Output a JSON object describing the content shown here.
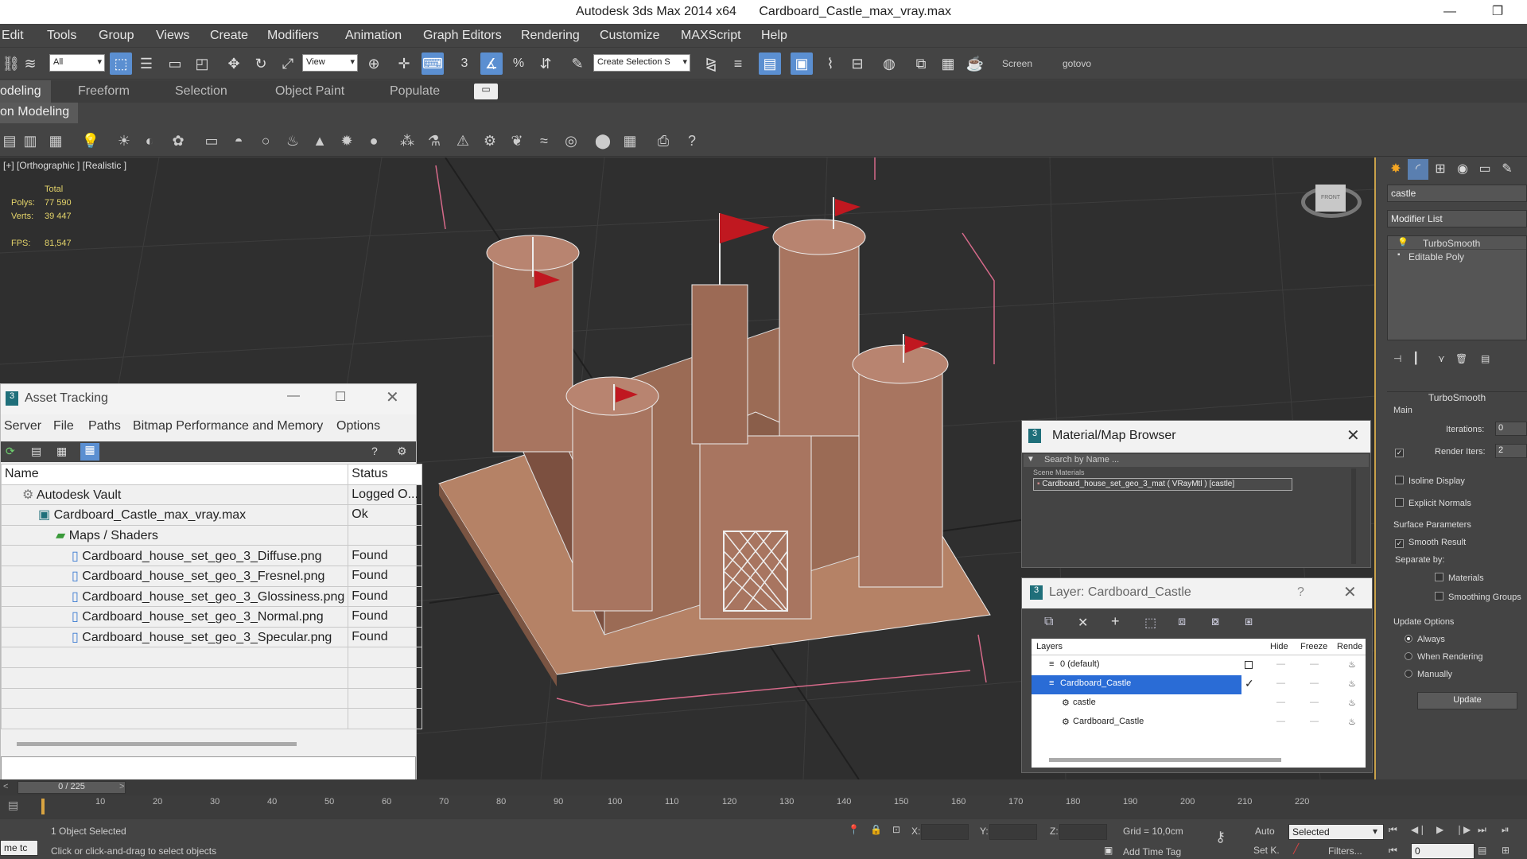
{
  "window": {
    "app_title": "Autodesk 3ds Max  2014 x64",
    "file_title": "Cardboard_Castle_max_vray.max",
    "minimize": "—",
    "restore": "❐"
  },
  "menu": [
    "Edit",
    "Tools",
    "Group",
    "Views",
    "Create",
    "Modifiers",
    "Animation",
    "Graph Editors",
    "Rendering",
    "Customize",
    "MAXScript",
    "Help"
  ],
  "toolbar": {
    "filter_select": "All",
    "view_select": "View",
    "selection_set_placeholder": "Create Selection S",
    "screen_label": "Screen",
    "gotovo_label": "gotovo",
    "snap_3": "3",
    "percent": "%"
  },
  "ribbon": {
    "tabs": [
      "odeling",
      "Freeform",
      "Selection",
      "Object Paint",
      "Populate"
    ],
    "sub_label": "on Modeling"
  },
  "viewport": {
    "label": "[+] [Orthographic ] [Realistic ]",
    "stats": {
      "total_label": "Total",
      "polys_label": "Polys:",
      "polys_value": "77 590",
      "verts_label": "Verts:",
      "verts_value": "39 447",
      "fps_label": "FPS:",
      "fps_value": "81,547"
    },
    "viewcube_label": "FRONT"
  },
  "command_panel": {
    "name_field": "castle",
    "modifier_list": "Modifier List",
    "stack": [
      "TurboSmooth",
      "Editable Poly"
    ],
    "rollout_title": "TurboSmooth",
    "main_label": "Main",
    "iterations_label": "Iterations:",
    "iterations_value": "0",
    "render_iters_label": "Render Iters:",
    "render_iters_value": "2",
    "isoline_label": "Isoline Display",
    "explicit_normals_label": "Explicit Normals",
    "surface_params_label": "Surface Parameters",
    "smooth_result_label": "Smooth Result",
    "separate_by_label": "Separate by:",
    "materials_label": "Materials",
    "smoothing_groups_label": "Smoothing Groups",
    "update_options_label": "Update Options",
    "always_label": "Always",
    "when_rendering_label": "When Rendering",
    "manually_label": "Manually",
    "update_button": "Update"
  },
  "asset_tracking": {
    "title": "Asset Tracking",
    "menu": [
      "Server",
      "File",
      "Paths",
      "Bitmap Performance and Memory",
      "Options"
    ],
    "columns": [
      "Name",
      "Status"
    ],
    "rows": [
      {
        "name": "Autodesk Vault",
        "status": "Logged O..."
      },
      {
        "name": "Cardboard_Castle_max_vray.max",
        "status": "Ok"
      },
      {
        "name": "Maps / Shaders",
        "status": ""
      },
      {
        "name": "Cardboard_house_set_geo_3_Diffuse.png",
        "status": "Found"
      },
      {
        "name": "Cardboard_house_set_geo_3_Fresnel.png",
        "status": "Found"
      },
      {
        "name": "Cardboard_house_set_geo_3_Glossiness.png",
        "status": "Found"
      },
      {
        "name": "Cardboard_house_set_geo_3_Normal.png",
        "status": "Found"
      },
      {
        "name": "Cardboard_house_set_geo_3_Specular.png",
        "status": "Found"
      }
    ]
  },
  "material_browser": {
    "title": "Material/Map Browser",
    "search_placeholder": "Search by Name ...",
    "section": "Scene Materials",
    "item": "Cardboard_house_set_geo_3_mat ( VRayMtl ) [castle]"
  },
  "layer_panel": {
    "title": "Layer: Cardboard_Castle",
    "help": "?",
    "columns": [
      "Layers",
      "Hide",
      "Freeze",
      "Rende"
    ],
    "rows": [
      {
        "name": "0 (default)",
        "indent": 0,
        "selected": false
      },
      {
        "name": "Cardboard_Castle",
        "indent": 0,
        "selected": true
      },
      {
        "name": "castle",
        "indent": 1,
        "selected": false
      },
      {
        "name": "Cardboard_Castle",
        "indent": 1,
        "selected": false
      }
    ]
  },
  "timeline": {
    "frame_counter": "0 / 225",
    "ticks": [
      "10",
      "20",
      "30",
      "40",
      "50",
      "60",
      "70",
      "80",
      "90",
      "100",
      "110",
      "120",
      "130",
      "140",
      "150",
      "160",
      "170",
      "180",
      "190",
      "200",
      "210",
      "220"
    ]
  },
  "status_bar": {
    "left_label": "me  tc",
    "selection_info": "1 Object Selected",
    "prompt": "Click or click-and-drag to select objects",
    "x_label": "X:",
    "y_label": "Y:",
    "z_label": "Z:",
    "grid": "Grid = 10,0cm",
    "add_time_tag": "Add Time Tag",
    "auto": "Auto",
    "set_key": "Set K.",
    "selected_dropdown": "Selected",
    "filters": "Filters...",
    "frame_value": "0"
  }
}
